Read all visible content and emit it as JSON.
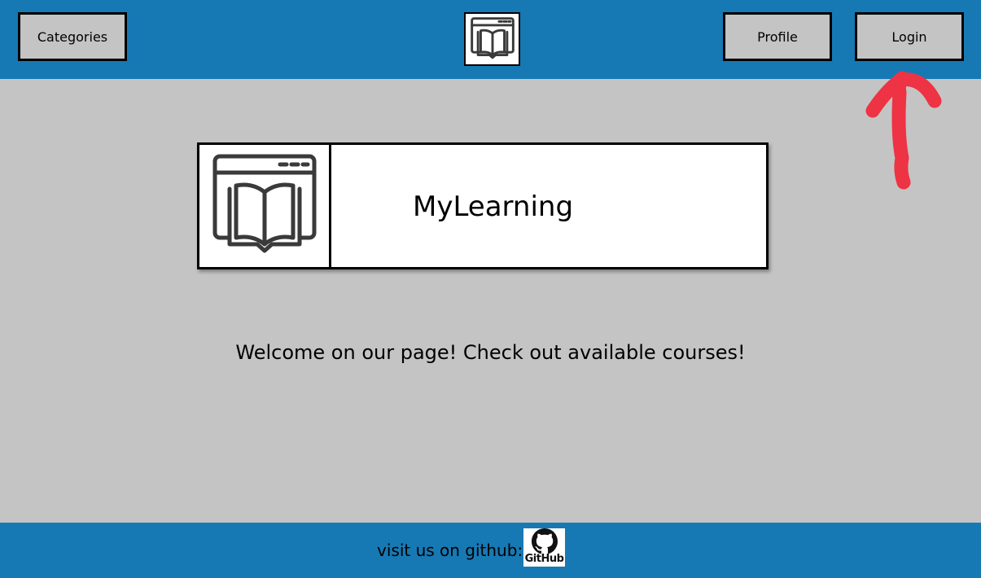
{
  "header": {
    "categories_label": "Categories",
    "profile_label": "Profile",
    "login_label": "Login",
    "logo_icon": "book-browser-icon"
  },
  "annotation": {
    "icon": "red-arrow-up-icon",
    "color": "#ee3344"
  },
  "hero": {
    "logo_icon": "book-browser-icon",
    "title": "MyLearning"
  },
  "main": {
    "welcome_text": "Welcome on our page! Check out available courses!"
  },
  "footer": {
    "text": "visit us on github:",
    "github_label": "GitHub",
    "github_icon": "github-icon"
  },
  "colors": {
    "header_bg": "#1779b4",
    "page_bg": "#c4c4c4",
    "button_bg": "#c4c4c4"
  }
}
